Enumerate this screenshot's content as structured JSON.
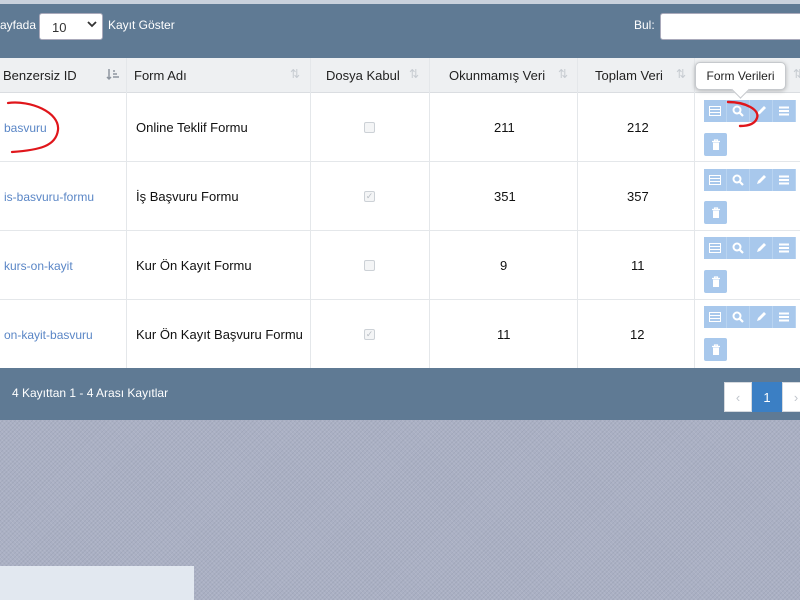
{
  "toolbar": {
    "length_prefix": "ayfada",
    "length_value": "10",
    "length_suffix": "Kayıt Göster",
    "search_label": "Bul:",
    "search_value": ""
  },
  "table": {
    "columns": [
      "Benzersiz ID",
      "Form Adı",
      "Dosya Kabul",
      "Okunmamış Veri",
      "Toplam Veri"
    ],
    "rows": [
      {
        "id": "basvuru",
        "name": "Online Teklif Formu",
        "file_accept": false,
        "unread": "211",
        "total": "212"
      },
      {
        "id": "is-basvuru-formu",
        "name": "İş Başvuru Formu",
        "file_accept": true,
        "unread": "351",
        "total": "357"
      },
      {
        "id": "kurs-on-kayit",
        "name": "Kur Ön Kayıt Formu",
        "file_accept": false,
        "unread": "9",
        "total": "11"
      },
      {
        "id": "on-kayit-basvuru",
        "name": "Kur Ön Kayıt Başvuru Formu",
        "file_accept": true,
        "unread": "11",
        "total": "12"
      }
    ],
    "action_icons": [
      "table-icon",
      "search-icon",
      "pencil-icon",
      "list-icon",
      "trash-icon"
    ]
  },
  "tooltip": {
    "text": "Form Verileri"
  },
  "footer": {
    "info": "4 Kayıttan 1 - 4 Arası Kayıtlar",
    "prev": "‹",
    "current_page": "1",
    "next": "›"
  },
  "colors": {
    "header_bar": "#5f7a94",
    "action_button": "#a8c8ec",
    "link": "#5a86c6",
    "active_page": "#3b7fc4",
    "annotation": "#e0161b"
  }
}
